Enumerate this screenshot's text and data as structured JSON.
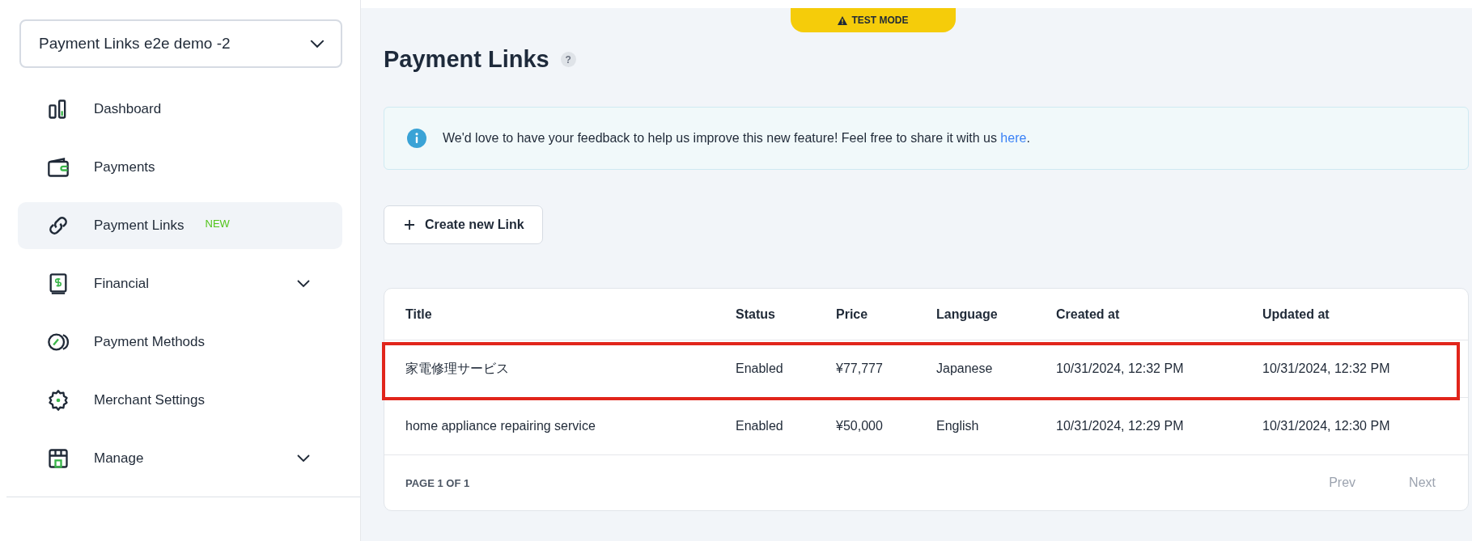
{
  "sidebar": {
    "account_selector": {
      "value": "Payment Links e2e demo -2"
    },
    "items": [
      {
        "label": "Dashboard",
        "kind": "chart",
        "selected": false,
        "expandable": false
      },
      {
        "label": "Payments",
        "kind": "wallet",
        "selected": false,
        "expandable": false
      },
      {
        "label": "Payment Links",
        "kind": "link",
        "selected": true,
        "expandable": false,
        "badge": "NEW"
      },
      {
        "label": "Financial",
        "kind": "book",
        "selected": false,
        "expandable": true
      },
      {
        "label": "Payment Methods",
        "kind": "coin",
        "selected": false,
        "expandable": false
      },
      {
        "label": "Merchant Settings",
        "kind": "gear",
        "selected": false,
        "expandable": false
      },
      {
        "label": "Manage",
        "kind": "store",
        "selected": false,
        "expandable": true
      }
    ]
  },
  "test_mode_badge": "TEST MODE",
  "page_title": "Payment Links",
  "help_icon": "?",
  "info_banner": {
    "text": "We'd love to have your feedback to help us improve this new feature! Feel free to share it with us ",
    "link": "here",
    "suffix": "."
  },
  "create_button": "Create new Link",
  "table": {
    "columns": [
      "Title",
      "Status",
      "Price",
      "Language",
      "Created at",
      "Updated at"
    ],
    "rows": [
      {
        "cells": [
          "家電修理サービス",
          "Enabled",
          "¥77,777",
          "Japanese",
          "10/31/2024, 12:32 PM",
          "10/31/2024, 12:32 PM"
        ],
        "highlighted": true
      },
      {
        "cells": [
          "home appliance repairing service",
          "Enabled",
          "¥50,000",
          "English",
          "10/31/2024, 12:29 PM",
          "10/31/2024, 12:30 PM"
        ],
        "highlighted": false
      }
    ],
    "pagination": {
      "label": "PAGE 1 OF 1",
      "prev": {
        "label": "Prev",
        "disabled": true
      },
      "next": {
        "label": "Next",
        "disabled": true
      }
    }
  }
}
